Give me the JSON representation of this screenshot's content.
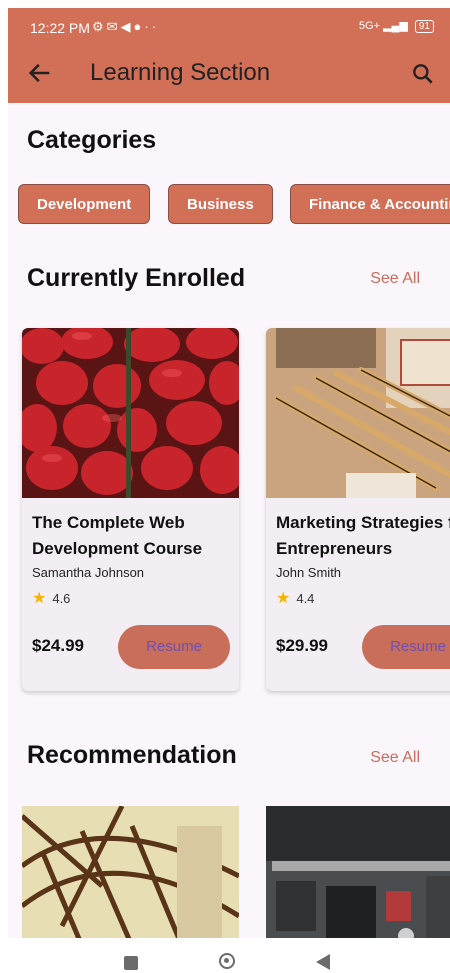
{
  "status_bar": {
    "time": "12:22 PM",
    "network": "5G+",
    "battery": "91"
  },
  "app_bar": {
    "title": "Learning Section",
    "back_icon": "arrow-left-icon",
    "search_icon": "search-icon",
    "color": "#d26f57"
  },
  "categories": {
    "title": "Categories",
    "chips": [
      "Development",
      "Business",
      "Finance & Accounting"
    ]
  },
  "enrolled": {
    "title": "Currently Enrolled",
    "see_all": "See All",
    "courses": [
      {
        "title": "The Complete Web Development Course",
        "author": "Samantha Johnson",
        "rating": "4.6",
        "price": "$24.99",
        "action": "Resume"
      },
      {
        "title": "Marketing Strategies for Entrepreneurs",
        "author": "John Smith",
        "rating": "4.4",
        "price": "$29.99",
        "action": "Resume"
      }
    ]
  },
  "recommendation": {
    "title": "Recommendation",
    "see_all": "See All"
  },
  "colors": {
    "accent": "#d26f57",
    "button_text": "#6e4fb3",
    "star": "#f5b400"
  }
}
